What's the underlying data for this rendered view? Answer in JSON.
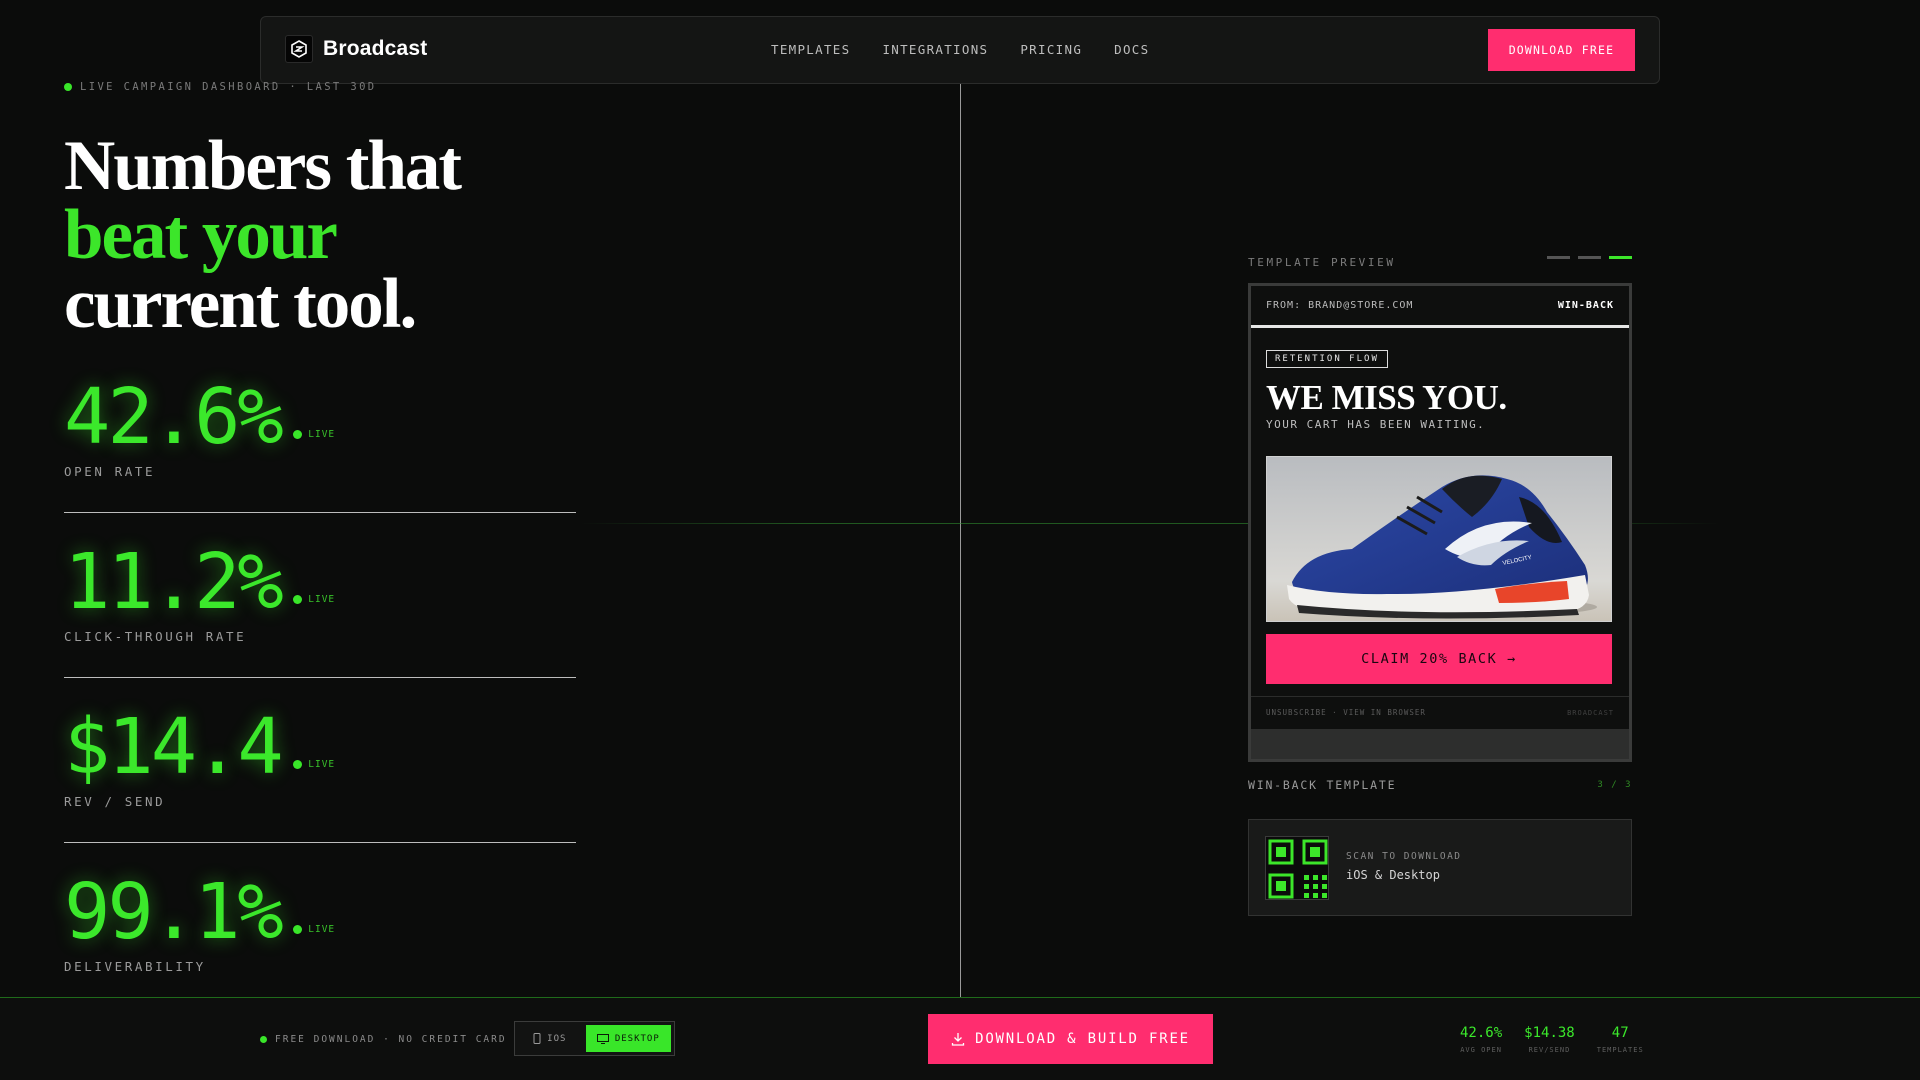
{
  "nav": {
    "brand": "Broadcast",
    "links": [
      "TEMPLATES",
      "INTEGRATIONS",
      "PRICING",
      "DOCS"
    ],
    "cta": "DOWNLOAD FREE"
  },
  "hero": {
    "eyebrow": "LIVE CAMPAIGN DASHBOARD · LAST 30D",
    "headline_line1": "Numbers that",
    "headline_line2": "beat your",
    "headline_line3": "current tool."
  },
  "metrics": [
    {
      "value": "42.6%",
      "live": "LIVE",
      "label": "OPEN RATE"
    },
    {
      "value": "11.2%",
      "live": "LIVE",
      "label": "CLICK-THROUGH RATE"
    },
    {
      "value": "$14.4",
      "live": "LIVE",
      "label": "REV / SEND"
    },
    {
      "value": "99.1%",
      "live": "LIVE",
      "label": "DELIVERABILITY"
    }
  ],
  "preview": {
    "title": "TEMPLATE PREVIEW",
    "active_page": 3,
    "email": {
      "from": "FROM: BRAND@STORE.COM",
      "tag": "WIN-BACK",
      "badge": "RETENTION FLOW",
      "heading": "WE MISS YOU.",
      "subheading": "YOUR CART HAS BEEN WAITING.",
      "shoe_brand": "VELOCITY",
      "cta": "CLAIM 20% BACK →",
      "footer_links": "UNSUBSCRIBE · VIEW IN BROWSER",
      "footer_brand": "BROADCAST"
    },
    "template_name": "WIN-BACK TEMPLATE",
    "template_count": "3 / 3",
    "qr": {
      "label": "SCAN TO DOWNLOAD",
      "value": "iOS & Desktop"
    }
  },
  "bottombar": {
    "note": "FREE DOWNLOAD · NO CREDIT CARD",
    "platform_ios": "IOS",
    "platform_desktop": "DESKTOP",
    "cta": "DOWNLOAD & BUILD FREE",
    "stats": [
      {
        "value": "42.6%",
        "label": "AVG OPEN"
      },
      {
        "value": "$14.38",
        "label": "REV/SEND"
      },
      {
        "value": "47",
        "label": "TEMPLATES"
      }
    ]
  },
  "colors": {
    "accent_green": "#3ce62a",
    "accent_pink": "#ff2d6f",
    "background": "#0b0c0b"
  }
}
